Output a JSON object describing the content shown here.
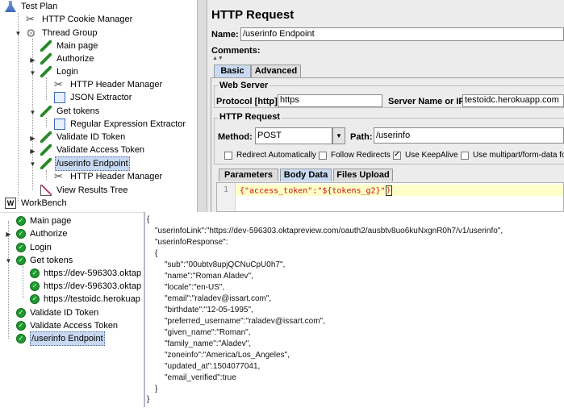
{
  "tree": {
    "test_plan": "Test Plan",
    "cookie_manager": "HTTP Cookie Manager",
    "thread_group": "Thread Group",
    "main_page": "Main page",
    "authorize": "Authorize",
    "login": "Login",
    "header_manager": "HTTP Header Manager",
    "json_extractor": "JSON Extractor",
    "get_tokens": "Get tokens",
    "regex_extractor": "Regular Expression Extractor",
    "validate_id": "Validate ID Token",
    "validate_access": "Validate Access Token",
    "userinfo": "/userinfo Endpoint",
    "header_manager2": "HTTP Header Manager",
    "view_results": "View Results Tree",
    "workbench": "WorkBench"
  },
  "panel": {
    "title": "HTTP Request",
    "name_label": "Name:",
    "name_value": "/userinfo Endpoint",
    "comments_label": "Comments:",
    "tab_basic": "Basic",
    "tab_advanced": "Advanced",
    "web_server_label": "Web Server",
    "protocol_label": "Protocol [http]:",
    "protocol_value": "https",
    "server_label": "Server Name or IP:",
    "server_value": "testoidc.herokuapp.com",
    "http_request_label": "HTTP Request",
    "method_label": "Method:",
    "method_value": "POST",
    "path_label": "Path:",
    "path_value": "/userinfo",
    "redirect_auto": "Redirect Automatically",
    "follow_redirects": "Follow Redirects",
    "keepalive": "Use KeepAlive",
    "multipart": "Use multipart/form-data for P",
    "tab_parameters": "Parameters",
    "tab_body": "Body Data",
    "tab_files": "Files Upload",
    "line_number": "1",
    "body_code": "{\"access_token\":\"${tokens_g2}\"",
    "body_cursor": "}"
  },
  "results": {
    "main_page": "Main page",
    "authorize": "Authorize",
    "login": "Login",
    "get_tokens": "Get tokens",
    "sub1": "https://dev-596303.oktap",
    "sub2": "https://dev-596303.oktap",
    "sub3": "https://testoidc.herokuap",
    "validate_id": "Validate ID Token",
    "validate_access": "Validate Access Token",
    "userinfo": "/userinfo Endpoint"
  },
  "json_lines": [
    "{",
    "\"userinfoLink\":\"https://dev-596303.oktapreview.com/oauth2/ausbtv8uo6kuNxgnR0h7/v1/userinfo\",",
    "\"userinfoResponse\":",
    "{",
    "\"sub\":\"00ubtv8upjQCNuCpU0h7\",",
    "\"name\":\"Roman Aladev\",",
    "\"locale\":\"en-US\",",
    "\"email\":\"raladev@issart.com\",",
    "\"birthdate\":\"12-05-1995\",",
    "\"preferred_username\":\"raladev@issart.com\",",
    "\"given_name\":\"Roman\",",
    "\"family_name\":\"Aladev\",",
    "\"zoneinfo\":\"America/Los_Angeles\",",
    "\"updated_at\":1504077041,",
    "\"email_verified\":true",
    "}",
    "}"
  ]
}
